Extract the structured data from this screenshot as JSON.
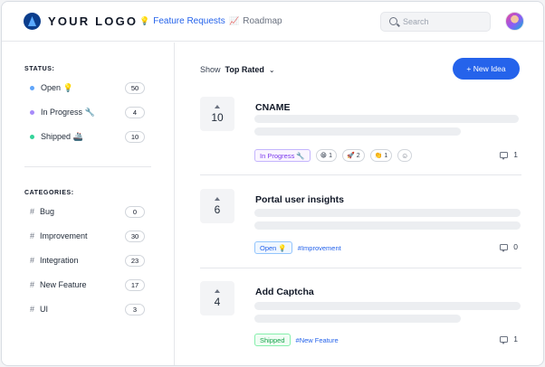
{
  "header": {
    "logo_text": "YOUR LOGO",
    "nav": [
      {
        "label": "Feature Requests",
        "icon": "lightbulb-icon",
        "active": true
      },
      {
        "label": "Roadmap",
        "icon": "chart-icon",
        "active": false
      }
    ],
    "search_placeholder": "Search"
  },
  "sidebar": {
    "status_title": "STATUS:",
    "statuses": [
      {
        "label": "Open 💡",
        "count": "50",
        "color": "#60a5fa"
      },
      {
        "label": "In Progress 🔧",
        "count": "4",
        "color": "#a78bfa"
      },
      {
        "label": "Shipped 🚢",
        "count": "10",
        "color": "#34d399"
      }
    ],
    "categories_title": "CATEGORIES:",
    "categories": [
      {
        "label": "Bug",
        "count": "0"
      },
      {
        "label": "Improvement",
        "count": "30"
      },
      {
        "label": "Integration",
        "count": "23"
      },
      {
        "label": "New Feature",
        "count": "17"
      },
      {
        "label": "UI",
        "count": "3"
      }
    ]
  },
  "main": {
    "sort_label": "Show",
    "sort_value": "Top Rated",
    "new_button": "+ New Idea",
    "posts": [
      {
        "votes": "10",
        "title": "CNAME",
        "status": "In Progress 🔧",
        "category": "",
        "reactions": [
          {
            "emoji": "😁",
            "count": "1"
          },
          {
            "emoji": "🚀",
            "count": "2"
          },
          {
            "emoji": "👏",
            "count": "1"
          }
        ],
        "comments": "1"
      },
      {
        "votes": "6",
        "title": "Portal user insights",
        "status": "Open 💡",
        "category": "#Improvement",
        "reactions": [],
        "comments": "0"
      },
      {
        "votes": "4",
        "title": "Add Captcha",
        "status": "Shipped",
        "category": "#New Feature",
        "reactions": [],
        "comments": "1"
      }
    ]
  },
  "colors": {
    "accent": "#2563eb",
    "in_progress": "#7c3aed",
    "open": "#2563eb",
    "shipped": "#16a34a"
  }
}
